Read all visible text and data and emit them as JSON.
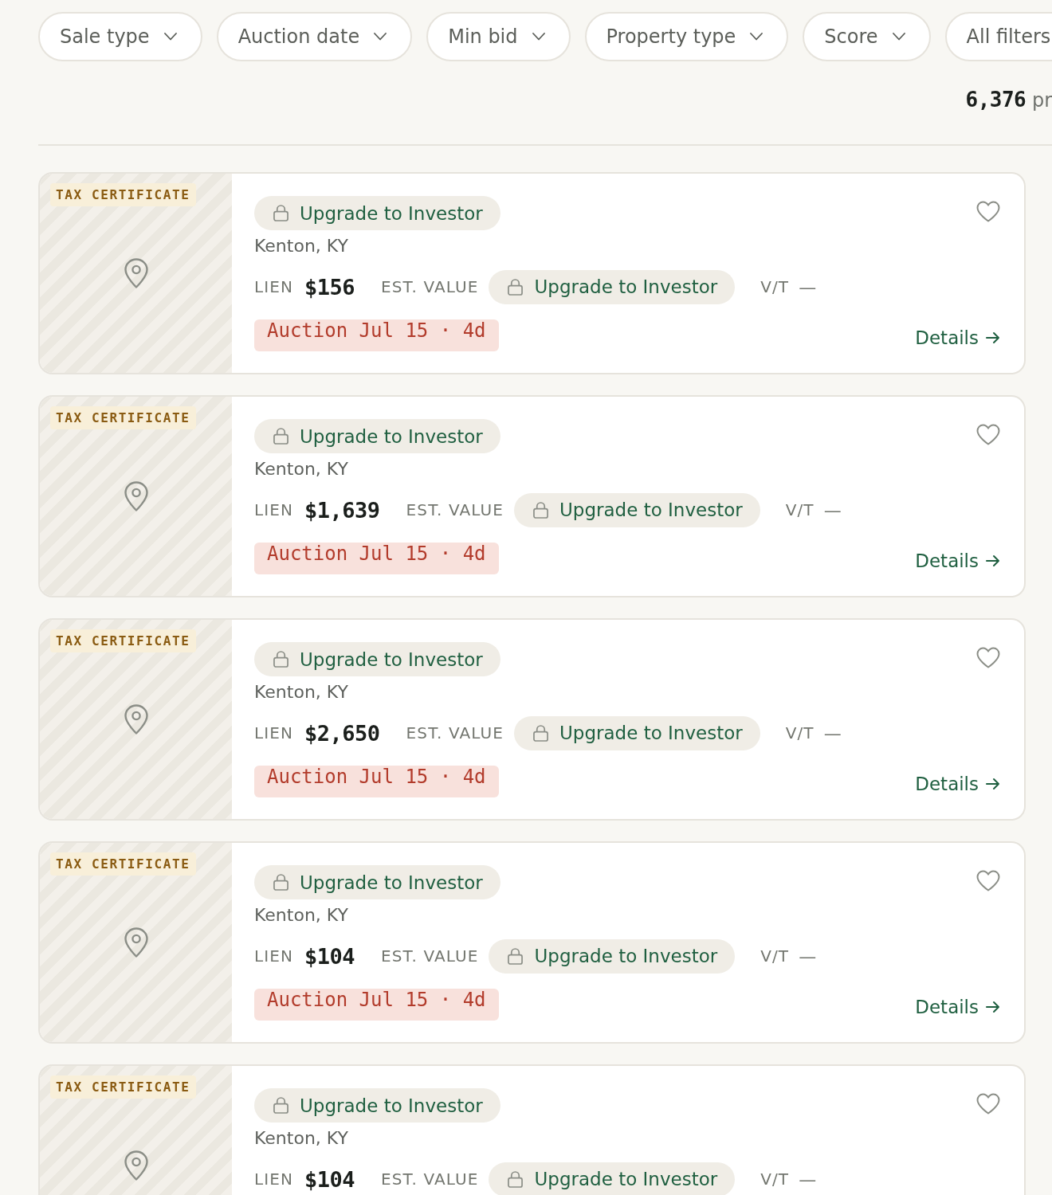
{
  "filters": [
    {
      "label": "Sale type",
      "kind": "dropdown"
    },
    {
      "label": "Auction date",
      "kind": "dropdown"
    },
    {
      "label": "Min bid",
      "kind": "dropdown"
    },
    {
      "label": "Property type",
      "kind": "dropdown"
    },
    {
      "label": "Score",
      "kind": "dropdown"
    },
    {
      "label": "All filters",
      "kind": "button"
    }
  ],
  "results": {
    "count": "6,376",
    "suffix": "pr"
  },
  "listings": [
    {
      "badge": "TAX CERTIFICATE",
      "upgrade_label": "Upgrade to Investor",
      "location": "Kenton, KY",
      "lien_label": "LIEN",
      "lien": "$156",
      "est_value_label": "EST. VALUE",
      "est_value_upgrade": "Upgrade to Investor",
      "vt_label": "V/T",
      "vt_value": "—",
      "auction": "Auction Jul 15 · 4d",
      "details": "Details",
      "favorited": false
    },
    {
      "badge": "TAX CERTIFICATE",
      "upgrade_label": "Upgrade to Investor",
      "location": "Kenton, KY",
      "lien_label": "LIEN",
      "lien": "$1,639",
      "est_value_label": "EST. VALUE",
      "est_value_upgrade": "Upgrade to Investor",
      "vt_label": "V/T",
      "vt_value": "—",
      "auction": "Auction Jul 15 · 4d",
      "details": "Details",
      "favorited": false
    },
    {
      "badge": "TAX CERTIFICATE",
      "upgrade_label": "Upgrade to Investor",
      "location": "Kenton, KY",
      "lien_label": "LIEN",
      "lien": "$2,650",
      "est_value_label": "EST. VALUE",
      "est_value_upgrade": "Upgrade to Investor",
      "vt_label": "V/T",
      "vt_value": "—",
      "auction": "Auction Jul 15 · 4d",
      "details": "Details",
      "favorited": false
    },
    {
      "badge": "TAX CERTIFICATE",
      "upgrade_label": "Upgrade to Investor",
      "location": "Kenton, KY",
      "lien_label": "LIEN",
      "lien": "$104",
      "est_value_label": "EST. VALUE",
      "est_value_upgrade": "Upgrade to Investor",
      "vt_label": "V/T",
      "vt_value": "—",
      "auction": "Auction Jul 15 · 4d",
      "details": "Details",
      "favorited": false
    },
    {
      "badge": "TAX CERTIFICATE",
      "upgrade_label": "Upgrade to Investor",
      "location": "Kenton, KY",
      "lien_label": "LIEN",
      "lien": "$104",
      "est_value_label": "EST. VALUE",
      "est_value_upgrade": "Upgrade to Investor",
      "vt_label": "V/T",
      "vt_value": "—",
      "favorited": false
    }
  ]
}
